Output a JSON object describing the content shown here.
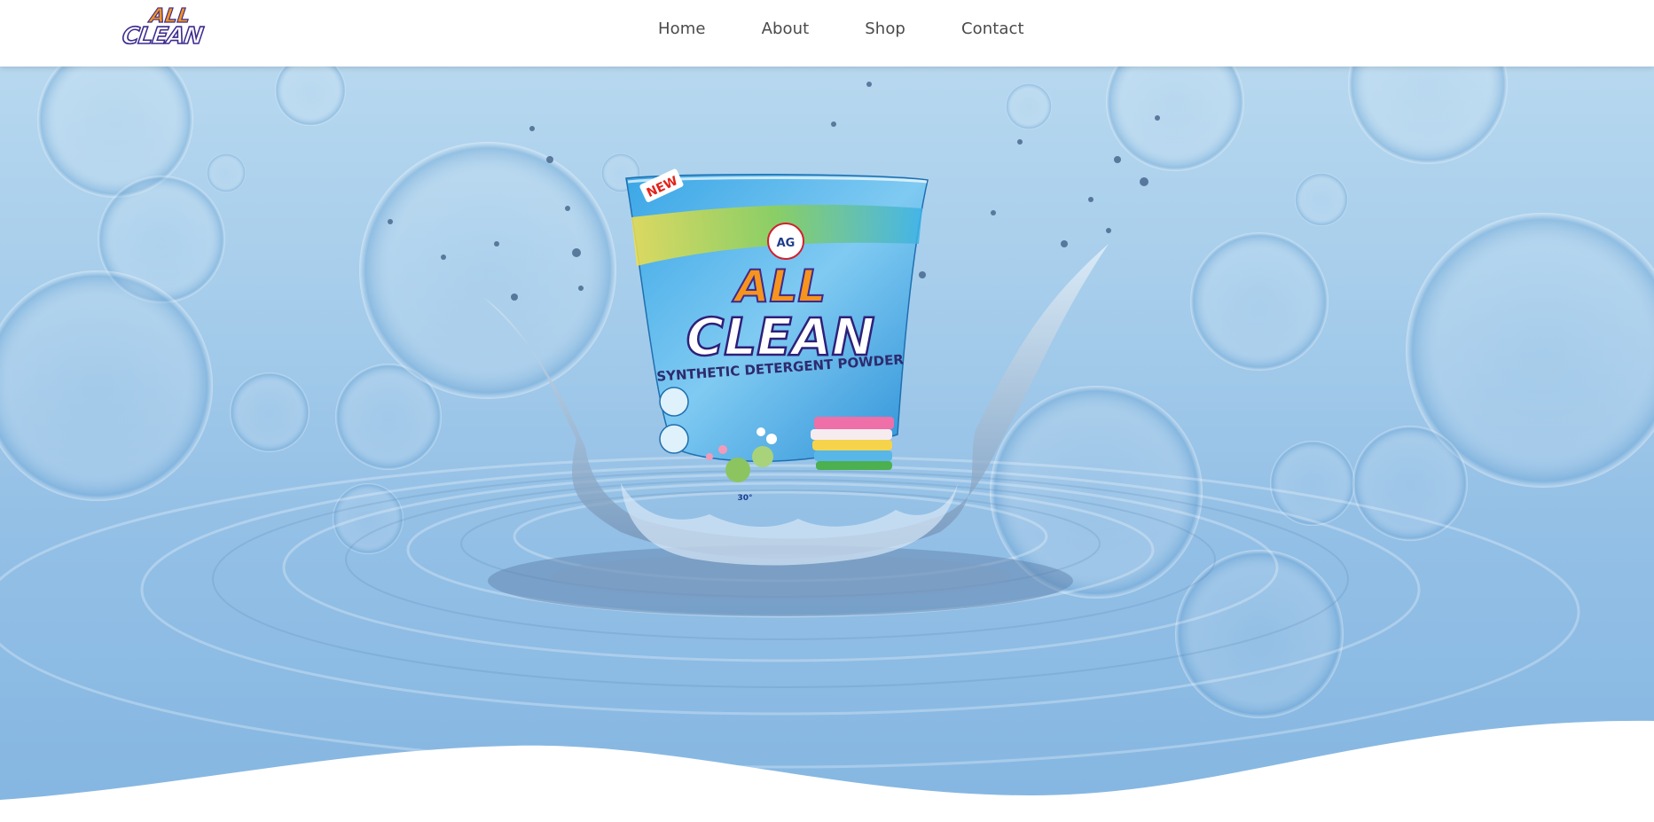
{
  "header": {
    "logo": {
      "line1": "ALL",
      "line2": "CLEAN"
    },
    "nav": [
      {
        "label": "Home"
      },
      {
        "label": "About"
      },
      {
        "label": "Shop"
      },
      {
        "label": "Contact"
      }
    ]
  },
  "hero": {
    "product": {
      "badge": "NEW",
      "brand_mark": "AG",
      "name_line1": "ALL",
      "name_line2": "CLEAN",
      "tagline": "SYNTHETIC DETERGENT POWDER",
      "temp": "30°"
    }
  },
  "colors": {
    "header_bg": "#ffffff",
    "nav_text": "#4a4a4a",
    "logo_orange": "#f7941d",
    "logo_purple": "#3d2a8e",
    "water_blue": "#94c0e6"
  }
}
